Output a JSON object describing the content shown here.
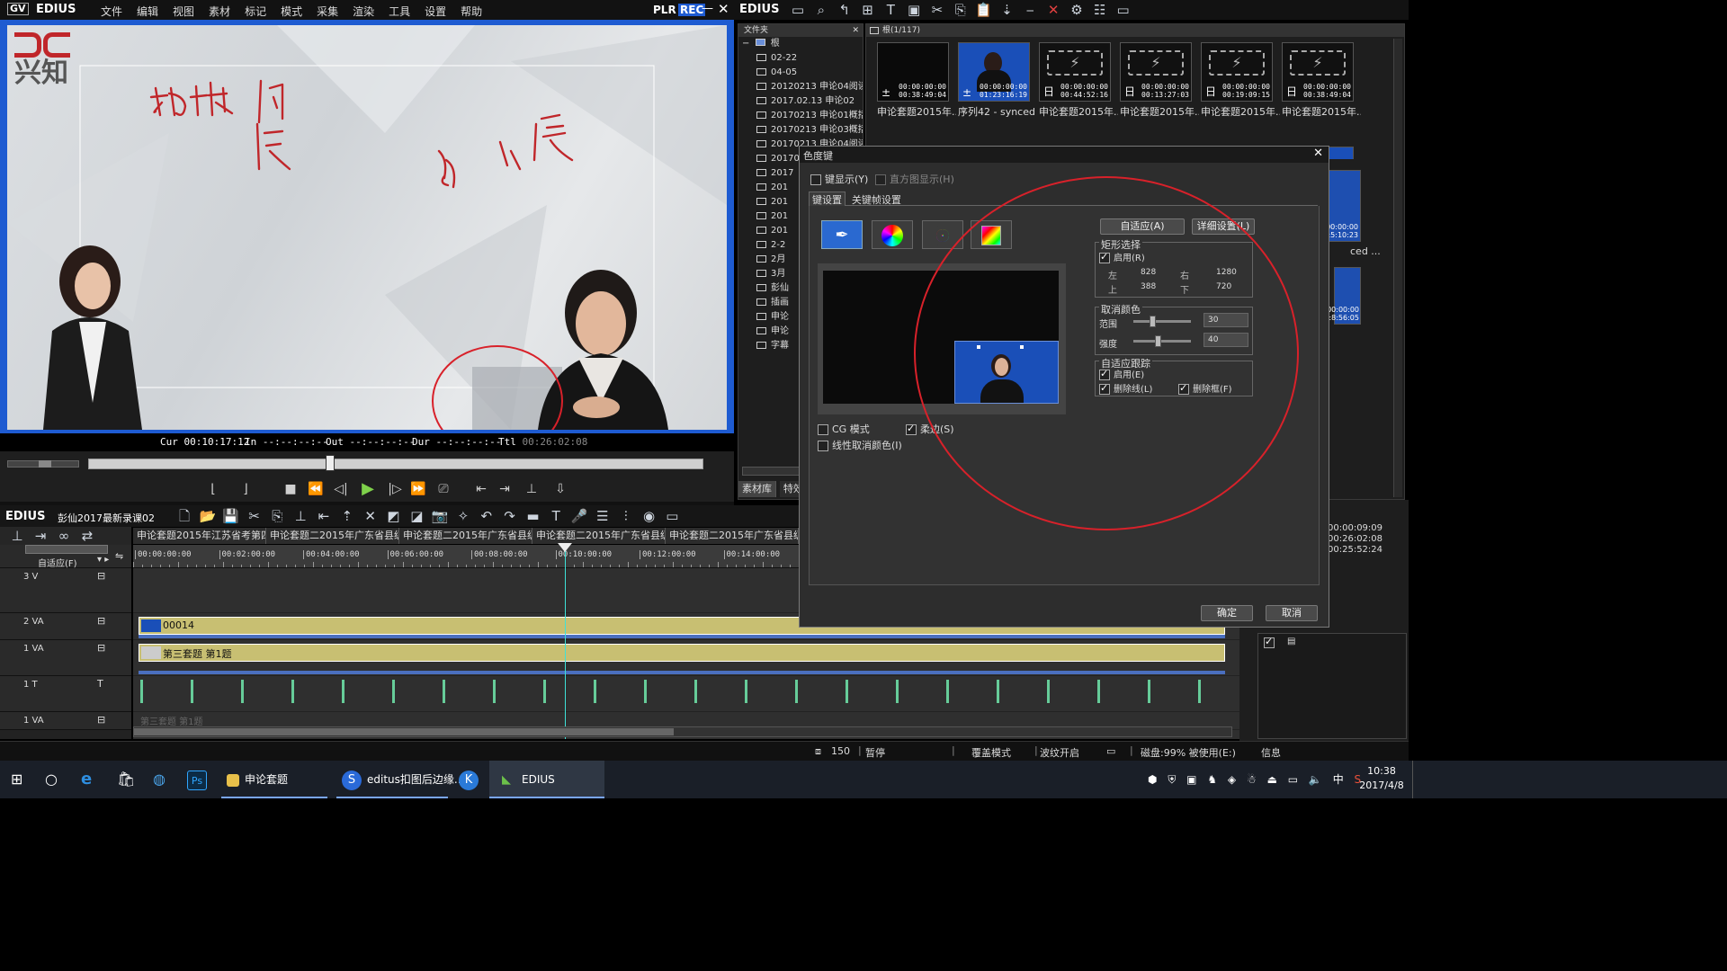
{
  "player": {
    "app_name": "EDIUS",
    "menu": [
      "文件",
      "编辑",
      "视图",
      "素材",
      "标记",
      "模式",
      "采集",
      "渲染",
      "工具",
      "设置",
      "帮助"
    ],
    "plr_label": "PLR",
    "rec_label": "REC",
    "watermark_text": "兴知",
    "timecodes": {
      "cur_label": "Cur",
      "cur_value": "00:10:17:12",
      "in_label": "In",
      "in_value": "--:--:--:--",
      "out_label": "Out",
      "out_value": "--:--:--:--",
      "dur_label": "Dur",
      "dur_value": "--:--:--:--",
      "ttl_label": "Ttl",
      "ttl_value": "00:26:02:08"
    }
  },
  "bin": {
    "app_name": "EDIUS",
    "folder_header": "文件夹",
    "clips_header": "根(1/117)",
    "root_label": "根",
    "tree": [
      "02-22",
      "04-05",
      "20120213 申论04阅读",
      "2017.02.13 申论02",
      "20170213 申论01概括",
      "20170213 申论03概括",
      "20170213 申论04阅读",
      "20170214 申论05概括",
      "2017",
      "201",
      "201",
      "201",
      "201",
      "2-2",
      "2月",
      "3月",
      "彭仙",
      "插画",
      "申论",
      "申论",
      "字幕"
    ],
    "thumbs": [
      {
        "label": "申论套题2015年...",
        "tc": "00:00:00:00\n00:38:49:04",
        "icon": "±"
      },
      {
        "label": "序列42 - synced ...",
        "tc": "00:00:00:00\n01:23:16:19",
        "icon": "±"
      },
      {
        "label": "申论套题2015年...",
        "tc": "00:00:00:00\n00:44:52:16",
        "icon": "日"
      },
      {
        "label": "申论套题2015年...",
        "tc": "00:00:00:00\n00:13:27:03",
        "icon": "日"
      },
      {
        "label": "申论套题2015年...",
        "tc": "00:00:00:00\n00:19:09:15",
        "icon": "日"
      },
      {
        "label": "申论套题2015年...",
        "tc": "00:00:00:00\n00:38:49:04",
        "icon": "日"
      }
    ],
    "right_partial": {
      "tc1": "0:00:00:00\n0:5:10:23",
      "label": "ced ...",
      "tc2": "0:00:00:00\n:8:56:05"
    },
    "tabs": [
      "素材库",
      "特效"
    ]
  },
  "timeline": {
    "app_name": "EDIUS",
    "project_name": "彭仙2017最新录课02",
    "sequence_tabs": [
      "申论套题2015年江苏省考第四...",
      "申论套题二2015年广东省县级...",
      "申论套题二2015年广东省县级...",
      "申论套题二2015年广东省县级...",
      "申论套题二2015年广东省县级..."
    ],
    "ruler": [
      "00:00:00:00",
      "00:02:00:00",
      "00:04:00:00",
      "00:06:00:00",
      "00:08:00:00",
      "00:10:00:00",
      "00:12:00:00",
      "00:14:00:00"
    ],
    "adapt_label": "自适应(F)",
    "tracks": [
      {
        "name": "3 V",
        "clip": ""
      },
      {
        "name": "2 VA",
        "clip": "00014"
      },
      {
        "name": "1 VA",
        "clip": "第三套题 第1题"
      },
      {
        "name": "1 T",
        "clip": ""
      },
      {
        "name": "1 VA",
        "clip": "第三套题 第1题"
      }
    ],
    "right_info": [
      "00:00:09:09",
      "00:26:02:08",
      "00:25:52:24"
    ],
    "info_tab": "信息"
  },
  "dialog": {
    "title": "色度键",
    "key_display": "键显示(Y)",
    "histogram_display": "直方图显示(H)",
    "tabs": [
      "键设置",
      "关键帧设置"
    ],
    "auto_button": "自适应(A)",
    "detail_button": "详细设置(L)",
    "rect_group": "矩形选择",
    "rect_enable": "启用(R)",
    "rect": {
      "left_label": "左",
      "left": "828",
      "right_label": "右",
      "right": "1280",
      "top_label": "上",
      "top": "388",
      "bottom_label": "下",
      "bottom": "720"
    },
    "cancel_color_group": "取消颜色",
    "range_label": "范围",
    "range_value": "30",
    "range_level": 0.3,
    "strength_label": "强度",
    "strength_value": "40",
    "strength_level": 0.4,
    "track_group": "自适应跟踪",
    "track_enable": "启用(E)",
    "remove_line": "删除线(L)",
    "remove_frame": "删除框(F)",
    "cg_mode": "CG 模式",
    "soft": "柔边(S)",
    "linear_cancel": "线性取消颜色(I)",
    "ok": "确定",
    "cancel": "取消"
  },
  "status": {
    "zoom": "150",
    "state": "暂停",
    "overwrite": "覆盖模式",
    "ripple": "波纹开启",
    "disk": "磁盘:99% 被使用(E:)"
  },
  "taskbar": {
    "items": [
      "申论套题",
      "editus扣图后边缘...",
      "EDIUS"
    ],
    "time": "10:38",
    "date": "2017/4/8",
    "ime": "中"
  },
  "colors": {
    "accent": "#1e5bd1",
    "red_mark": "#d8212a",
    "track_yellow": "#c8bf72"
  }
}
